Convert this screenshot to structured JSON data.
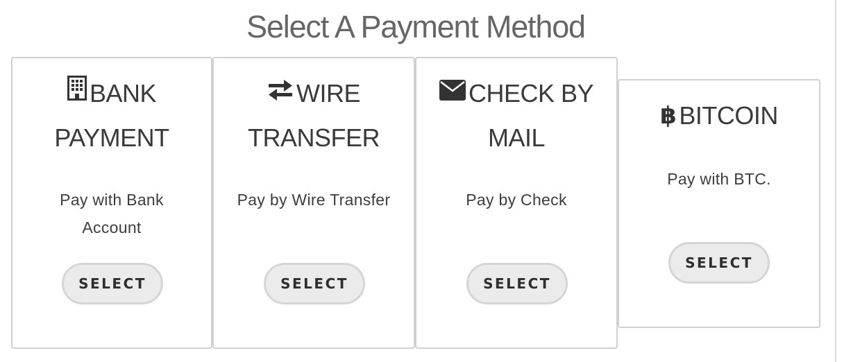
{
  "page": {
    "title": "Select A Payment Method"
  },
  "methods": [
    {
      "icon": "building-icon",
      "title_line1": "BANK",
      "title_line2": "PAYMENT",
      "description_line1": "Pay with Bank",
      "description_line2": "Account",
      "button_label": "SELECT"
    },
    {
      "icon": "exchange-arrows-icon",
      "title_line1": "WIRE",
      "title_line2": "TRANSFER",
      "description_line1": "Pay by Wire Transfer",
      "button_label": "SELECT"
    },
    {
      "icon": "envelope-icon",
      "title_line1": "CHECK BY",
      "title_line2": "MAIL",
      "description_line1": "Pay by Check",
      "button_label": "SELECT"
    },
    {
      "icon": "bitcoin-icon",
      "title_line1": "BITCOIN",
      "description_line1": "Pay with BTC.",
      "button_label": "SELECT"
    }
  ]
}
